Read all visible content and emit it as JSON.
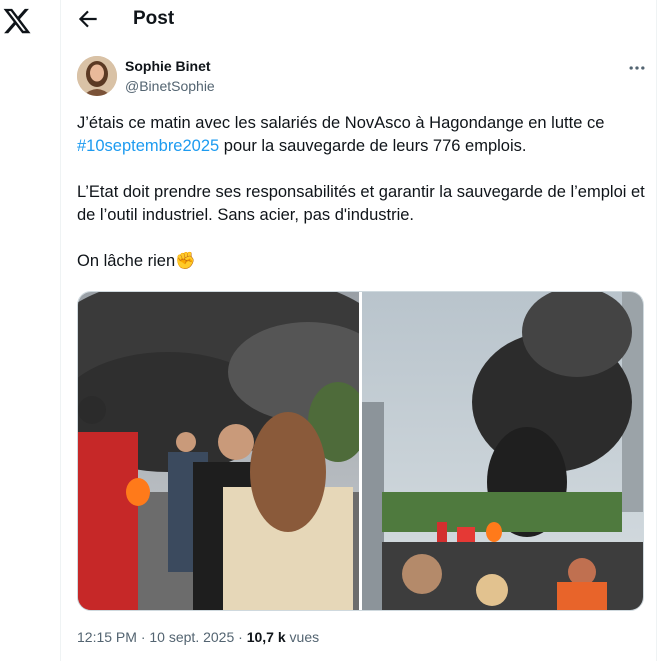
{
  "header": {
    "title": "Post"
  },
  "author": {
    "name": "Sophie Binet",
    "handle": "@BinetSophie"
  },
  "post": {
    "line1_before": "J’étais ce matin avec les salariés de NovAsco à Hagondange en lutte ce",
    "hashtag": "#10septembre2025",
    "line2_after": " pour la sauvegarde de leurs 776 emplois.",
    "paragraph2": "L’Etat doit prendre ses responsabilités et garantir la sauvegarde de l’emploi et de l’outil industriel. Sans acier, pas d'industrie.",
    "paragraph3_text": "On lâche rien",
    "paragraph3_emoji": "✊"
  },
  "meta": {
    "time": "12:15 PM",
    "separator": " · ",
    "date": "10 sept. 2025",
    "views_count": "10,7 k",
    "views_label": " vues"
  },
  "colors": {
    "accent": "#1d9bf0",
    "text": "#0f1419",
    "muted": "#536471",
    "border": "#eff3f4"
  },
  "icons": {
    "logo": "x-logo-icon",
    "back": "arrow-left-icon",
    "more": "more-dots-icon"
  }
}
